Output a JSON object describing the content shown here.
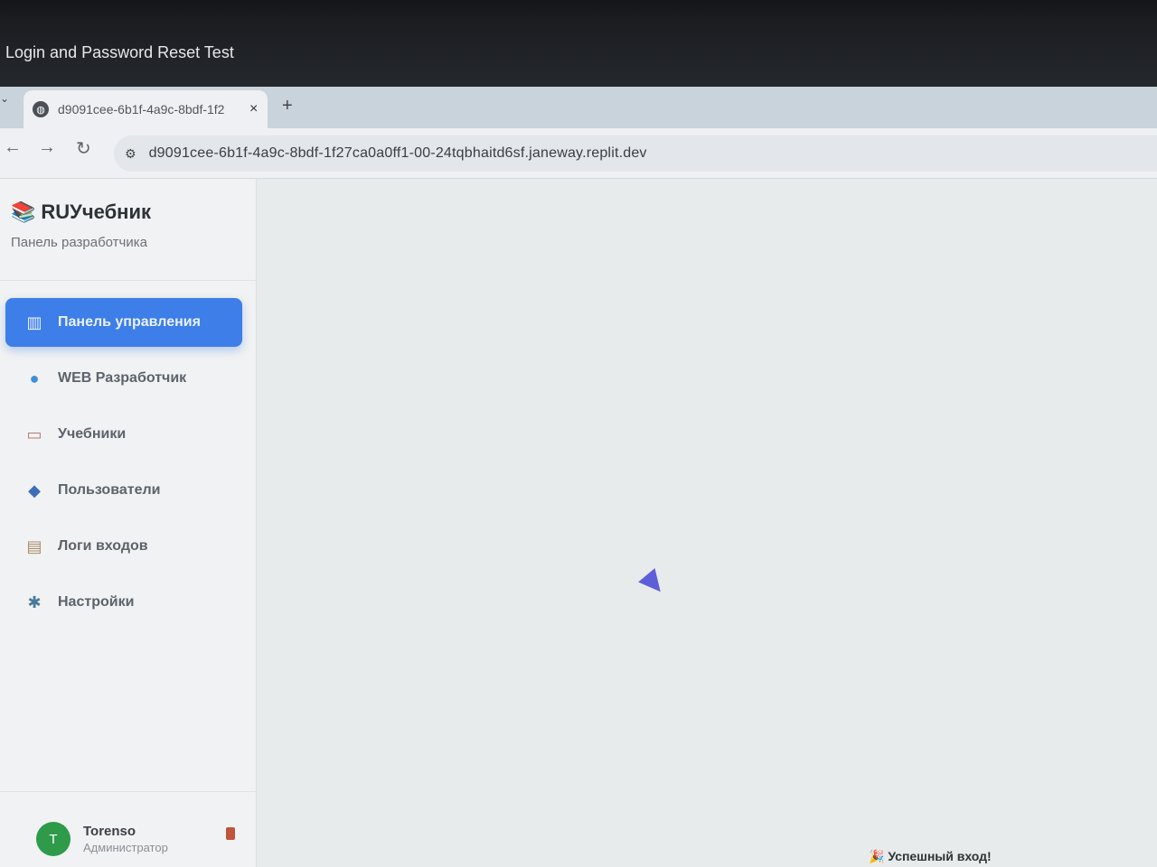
{
  "window": {
    "title": "Login and Password Reset Test"
  },
  "browser": {
    "tab": {
      "title": "d9091cee-6b1f-4a9c-8bdf-1f2",
      "close_symbol": "×"
    },
    "new_tab_symbol": "+",
    "url": "d9091cee-6b1f-4a9c-8bdf-1f27ca0a0ff1-00-24tqbhaitd6sf.janeway.replit.dev"
  },
  "sidebar": {
    "brand": {
      "name": "RUУчебник",
      "subtitle": "Панель разработчика"
    },
    "items": [
      {
        "label": "Панель управления",
        "icon": "bar-chart-icon",
        "glyph": "▥",
        "active": true
      },
      {
        "label": "WEB Разработчик",
        "icon": "globe-icon",
        "glyph": "●",
        "active": false
      },
      {
        "label": "Учебники",
        "icon": "book-icon",
        "glyph": "▭",
        "active": false
      },
      {
        "label": "Пользователи",
        "icon": "users-icon",
        "glyph": "◆",
        "active": false
      },
      {
        "label": "Логи входов",
        "icon": "clipboard-icon",
        "glyph": "▤",
        "active": false
      },
      {
        "label": "Настройки",
        "icon": "gear-icon",
        "glyph": "✱",
        "active": false
      }
    ],
    "user": {
      "initial": "T",
      "name": "Torenso",
      "role": "Администратор"
    }
  },
  "toast": {
    "icon": "party-icon",
    "text": "Успешный вход!"
  },
  "colors": {
    "accent": "#3d7ee8",
    "avatar": "#2e9a4a",
    "logout": "#c0543a"
  }
}
